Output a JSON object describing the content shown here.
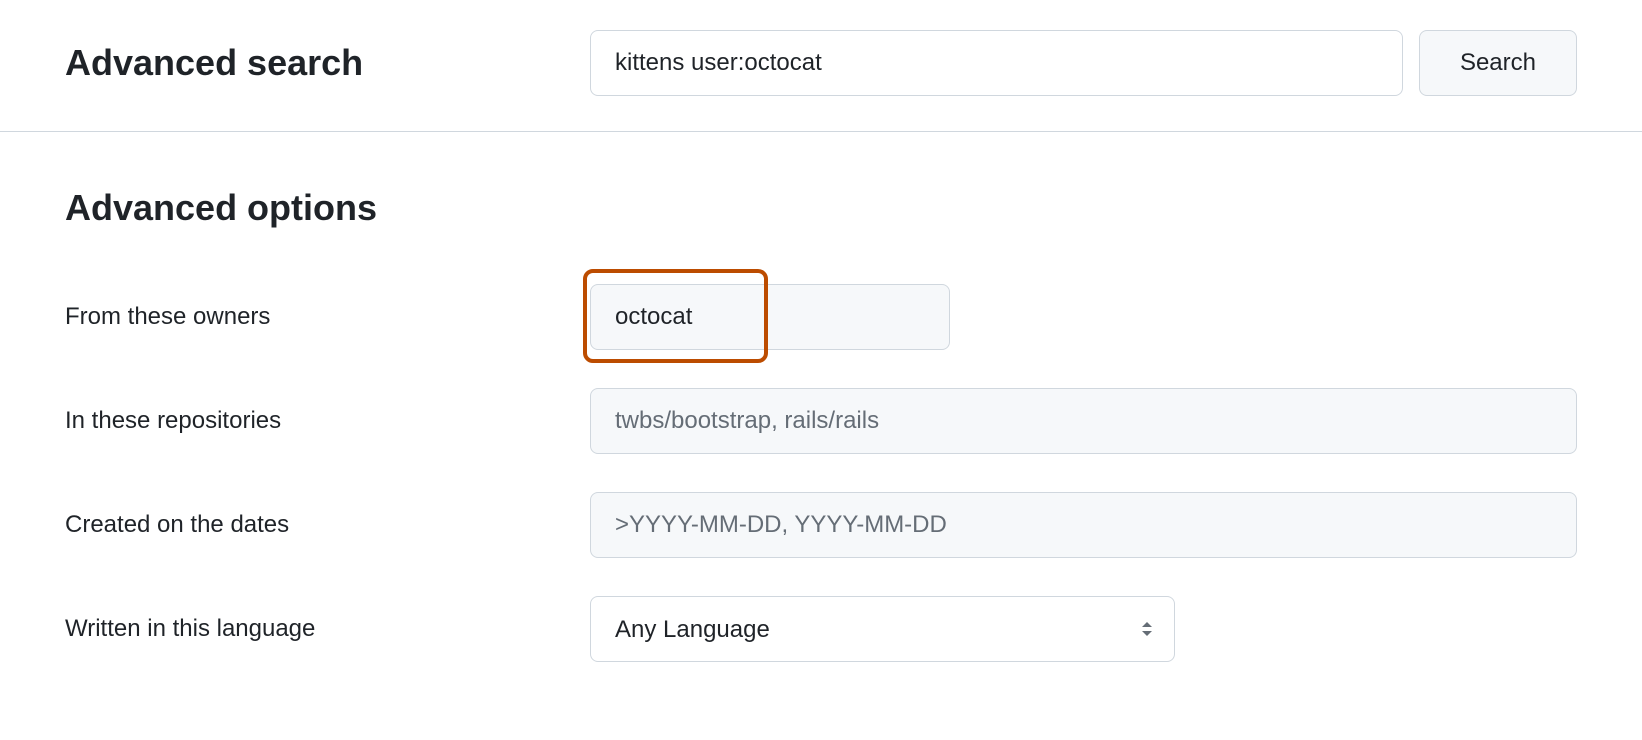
{
  "header": {
    "title": "Advanced search",
    "search_value": "kittens user:octocat",
    "search_button_label": "Search"
  },
  "options": {
    "section_title": "Advanced options",
    "rows": [
      {
        "label": "From these owners",
        "value": "octocat",
        "placeholder": "",
        "highlighted": true
      },
      {
        "label": "In these repositories",
        "value": "",
        "placeholder": "twbs/bootstrap, rails/rails",
        "highlighted": false
      },
      {
        "label": "Created on the dates",
        "value": "",
        "placeholder": ">YYYY-MM-DD, YYYY-MM-DD",
        "highlighted": false
      }
    ],
    "language_label": "Written in this language",
    "language_value": "Any Language"
  }
}
